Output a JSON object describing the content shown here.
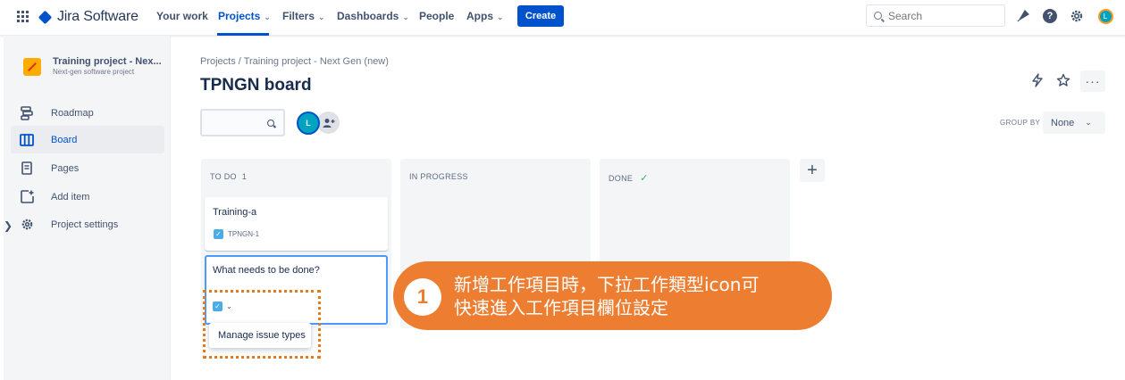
{
  "nav": {
    "brand": "Jira Software",
    "your_work": "Your work",
    "projects": "Projects",
    "filters": "Filters",
    "dashboards": "Dashboards",
    "people": "People",
    "apps": "Apps",
    "create": "Create",
    "search_placeholder": "Search",
    "avatar_initial": "L"
  },
  "sidebar": {
    "project_name": "Training project - Nex...",
    "project_type": "Next-gen software project",
    "items": [
      {
        "label": "Roadmap"
      },
      {
        "label": "Board"
      },
      {
        "label": "Pages"
      },
      {
        "label": "Add item"
      },
      {
        "label": "Project settings"
      }
    ]
  },
  "main": {
    "breadcrumb": "Projects / Training project - Next Gen (new)",
    "title": "TPNGN board",
    "avatar_initial": "L",
    "group_by_label": "GROUP BY",
    "group_by_value": "None"
  },
  "columns": [
    {
      "title": "TO DO",
      "count": "1"
    },
    {
      "title": "IN PROGRESS",
      "count": ""
    },
    {
      "title": "DONE",
      "count": ""
    }
  ],
  "cards": [
    {
      "title": "Training-a",
      "key": "TPNGN-1"
    }
  ],
  "new_card": {
    "placeholder": "What needs to be done?",
    "menu_item": "Manage issue types"
  },
  "callout": {
    "number": "1",
    "line1": "新增工作項目時，下拉工作類型icon可",
    "line2": "快速進入工作項目欄位設定"
  },
  "colors": {
    "accent": "#0052CC",
    "callout": "#ED7D31",
    "done_check": "#36B37E"
  }
}
